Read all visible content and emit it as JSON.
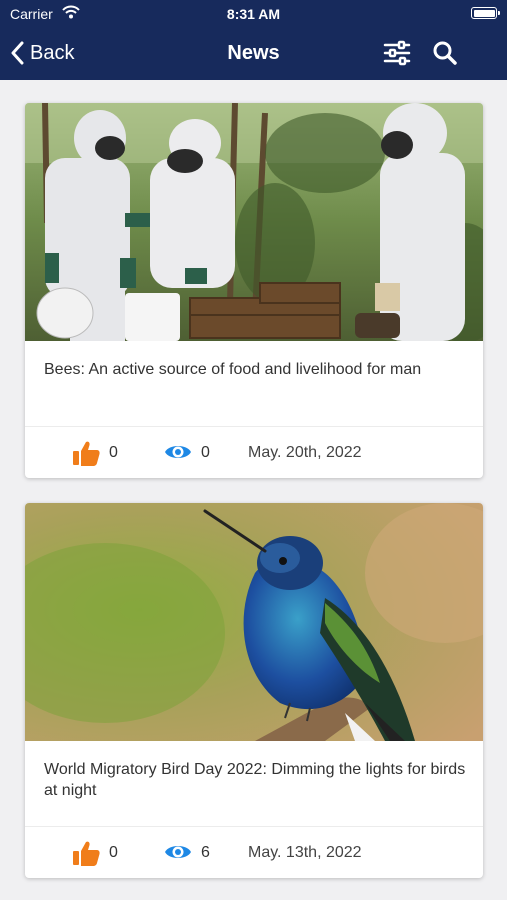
{
  "status_bar": {
    "carrier": "Carrier",
    "time": "8:31 AM"
  },
  "nav": {
    "back_label": "Back",
    "title": "News",
    "icons": [
      "filter-icon",
      "search-icon"
    ]
  },
  "articles": [
    {
      "headline": "Bees: An active source of food and livelihood for man",
      "likes": "0",
      "views": "0",
      "date": "May. 20th, 2022",
      "image": "beekeepers-in-protective-suits"
    },
    {
      "headline": "World Migratory Bird Day 2022: Dimming the lights for birds at night",
      "likes": "0",
      "views": "6",
      "date": "May. 13th, 2022",
      "image": "hummingbird-on-branch"
    }
  ],
  "colors": {
    "header_bg": "#172a5c",
    "like": "#f07d1a",
    "view": "#1e88e5",
    "page_bg": "#f0f0f2"
  }
}
